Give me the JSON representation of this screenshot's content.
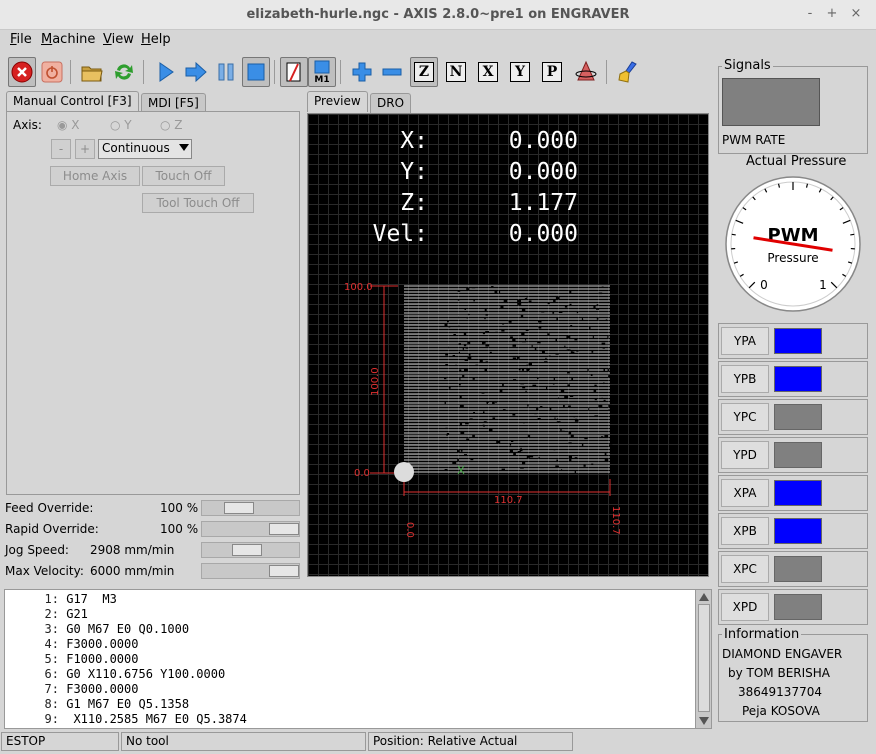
{
  "window": {
    "title": "elizabeth-hurle.ngc - AXIS 2.8.0~pre1 on ENGRAVER",
    "controls": [
      "-",
      "+",
      "×"
    ]
  },
  "menu": [
    {
      "label": "File",
      "u": "F",
      "rest": "ile"
    },
    {
      "label": "Machine",
      "u": "M",
      "rest": "achine"
    },
    {
      "label": "View",
      "u": "V",
      "rest": "iew"
    },
    {
      "label": "Help",
      "u": "H",
      "rest": "elp"
    }
  ],
  "toolbar": {
    "letters": [
      "Z",
      "N",
      "X",
      "Y",
      "P"
    ],
    "colors": {
      "estop_red": "#d62020",
      "blue": "#3a8ee6",
      "green": "#2e9e2e"
    }
  },
  "left_tabs": [
    "Manual Control [F3]",
    "MDI [F5]"
  ],
  "manual": {
    "axis_label": "Axis:",
    "axes": [
      "X",
      "Y",
      "Z"
    ],
    "minus": "-",
    "plus": "+",
    "jog_mode": "Continuous",
    "home_axis": "Home Axis",
    "touch_off": "Touch Off",
    "tool_touch_off": "Tool Touch Off"
  },
  "overrides": [
    {
      "label": "Feed Override:",
      "value": "100 %",
      "level": 0.33
    },
    {
      "label": "Rapid Override:",
      "value": "100 %",
      "level": 1.0
    },
    {
      "label": "Jog Speed:",
      "value": "2908 mm/min",
      "level": 0.45
    },
    {
      "label": "Max Velocity:",
      "value": "6000 mm/min",
      "level": 1.0
    }
  ],
  "preview_tabs": [
    "Preview",
    "DRO"
  ],
  "dro": [
    {
      "axis": "X:",
      "value": "0.000"
    },
    {
      "axis": "Y:",
      "value": "0.000"
    },
    {
      "axis": "Z:",
      "value": "1.177"
    },
    {
      "axis": "Vel:",
      "value": "0.000"
    }
  ],
  "extents": {
    "y_max": "100.0",
    "y_min": "0.0",
    "y_span": "100.0",
    "x_min": "0.0",
    "x_max": "110.7",
    "x_span": "110.7",
    "color": "#e03030"
  },
  "gcode": [
    {
      "n": "1:",
      "text": "G17  M3"
    },
    {
      "n": "2:",
      "text": "G21"
    },
    {
      "n": "3:",
      "text": "G0 M67 E0 Q0.1000"
    },
    {
      "n": "4:",
      "text": "F3000.0000"
    },
    {
      "n": "5:",
      "text": "F1000.0000"
    },
    {
      "n": "6:",
      "text": "G0 X110.6756 Y100.0000"
    },
    {
      "n": "7:",
      "text": "F3000.0000"
    },
    {
      "n": "8:",
      "text": "G1 M67 E0 Q5.1358"
    },
    {
      "n": "9:",
      "text": " X110.2585 M67 E0 Q5.3874"
    }
  ],
  "status": {
    "state": "ESTOP",
    "tool": "No tool",
    "position": "Position: Relative Actual"
  },
  "signals": {
    "title": "Signals",
    "pwm_label": "PWM RATE",
    "pwm_color": "#808080",
    "gauge_title": "Actual Pressure",
    "gauge_main": "PWM",
    "gauge_sub": "Pressure",
    "gauge_min": "0",
    "gauge_max": "1",
    "gauge_level": 0.2
  },
  "leds": [
    {
      "label": "YPA",
      "color": "#0000ff"
    },
    {
      "label": "YPB",
      "color": "#0000ff"
    },
    {
      "label": "YPC",
      "color": "#808080"
    },
    {
      "label": "YPD",
      "color": "#808080"
    },
    {
      "label": "XPA",
      "color": "#0000ff"
    },
    {
      "label": "XPB",
      "color": "#0000ff"
    },
    {
      "label": "XPC",
      "color": "#808080"
    },
    {
      "label": "XPD",
      "color": "#808080"
    }
  ],
  "info": {
    "title": "Information",
    "lines": [
      "DIAMOND ENGAVER",
      "by  TOM BERISHA",
      "38649137704",
      "Peja KOSOVA"
    ]
  }
}
